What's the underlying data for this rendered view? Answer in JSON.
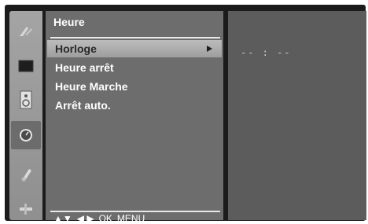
{
  "menu": {
    "title": "Heure",
    "items": [
      {
        "label": "Horloge",
        "selected": true
      },
      {
        "label": "Heure arrêt",
        "selected": false
      },
      {
        "label": "Heure Marche",
        "selected": false
      },
      {
        "label": "Arrêt auto.",
        "selected": false
      }
    ],
    "nav_hint": {
      "arrows_updown": "▲▼",
      "arrows_leftright": "◀ ▶",
      "ok": "OK",
      "menu": "MENU"
    }
  },
  "side_icons": [
    {
      "name": "picture-icon"
    },
    {
      "name": "screen-icon"
    },
    {
      "name": "audio-speaker-icon"
    },
    {
      "name": "clock-time-icon",
      "active": true
    },
    {
      "name": "option-icon"
    },
    {
      "name": "setup-icon"
    }
  ],
  "detail": {
    "clock_value": "-- : --"
  },
  "colors": {
    "frame": "#1b1b1b",
    "icon_column": "#9a9a9a",
    "menu_panel": "#6d6d6d",
    "selection_bar": "#b0b0b0",
    "detail_panel": "#5c5c5c"
  }
}
